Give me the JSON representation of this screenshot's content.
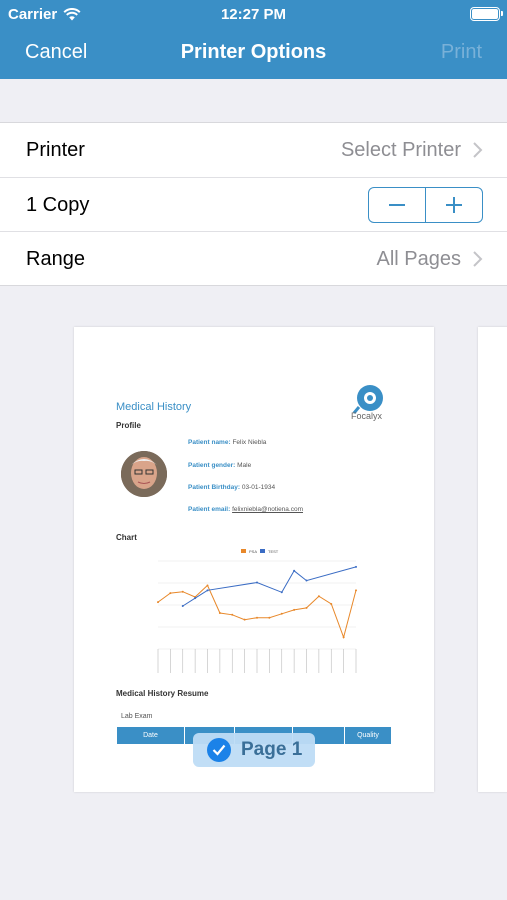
{
  "status_bar": {
    "carrier": "Carrier",
    "time": "12:27 PM"
  },
  "nav": {
    "cancel": "Cancel",
    "title": "Printer Options",
    "print": "Print"
  },
  "settings": {
    "printer_label": "Printer",
    "printer_value": "Select Printer",
    "copies_label": "1 Copy",
    "range_label": "Range",
    "range_value": "All Pages"
  },
  "document": {
    "title": "Medical History",
    "logo_text": "Focalyx",
    "profile_heading": "Profile",
    "patient_name_label": "Patient name:",
    "patient_name": "Felix Niebla",
    "patient_gender_label": "Patient gender:",
    "patient_gender": "Male",
    "patient_birthday_label": "Patient Birthday:",
    "patient_birthday": "03-01-1934",
    "patient_email_label": "Patient email:",
    "patient_email": "felixniebla@notiena.com",
    "chart_heading": "Chart",
    "resume_heading": "Medical History Resume",
    "lab_exam": "Lab Exam",
    "table_headers": [
      "Date",
      "",
      "",
      "",
      "Quality"
    ],
    "legend": [
      "PSA",
      "TEST"
    ]
  },
  "chart_data": {
    "type": "line",
    "series": [
      {
        "name": "PSA",
        "values": [
          2.4,
          2.86,
          2.93,
          2.66,
          3.25,
          1.84,
          1.75,
          1.5,
          1.6,
          1.6,
          1.8,
          2.0,
          2.1,
          2.7,
          2.3,
          0.6,
          3.0
        ]
      },
      {
        "name": "TEST",
        "values": [
          null,
          null,
          2.2,
          2.6,
          3.0,
          null,
          null,
          null,
          3.4,
          null,
          2.9,
          4.0,
          3.5,
          null,
          null,
          null,
          4.2
        ]
      }
    ]
  },
  "page_badge": {
    "label": "Page 1"
  },
  "colors": {
    "accent": "#3a8fc6",
    "psa": "#e8882a",
    "test": "#3a6cc4"
  }
}
